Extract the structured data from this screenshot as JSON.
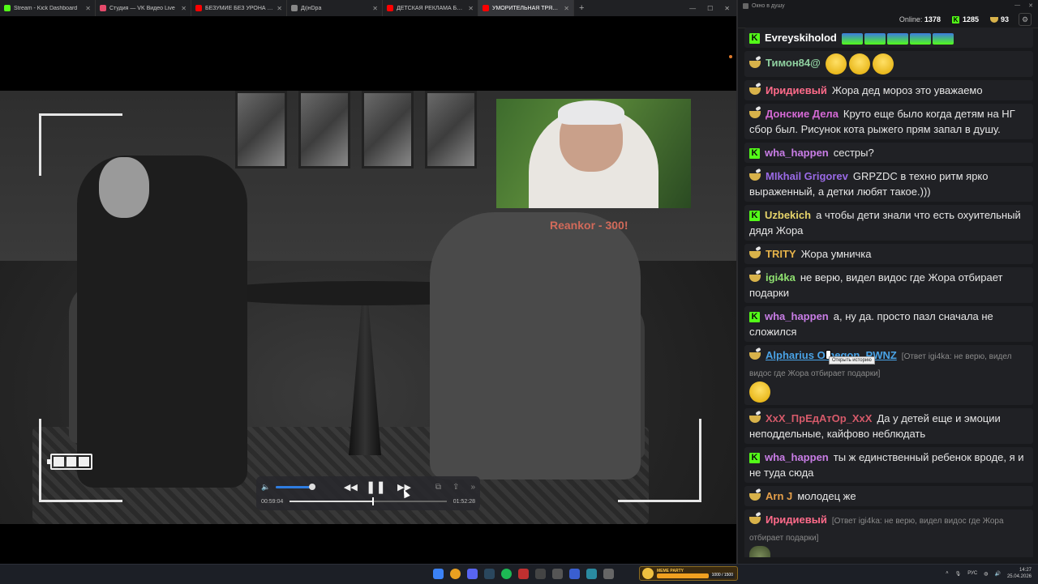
{
  "browser": {
    "tabs": [
      {
        "title": "Stream - Kick Dashboard",
        "favicon_color": "#53fc18",
        "active": false
      },
      {
        "title": "Студия — VK Видео Live",
        "favicon_color": "#e64a6b",
        "active": false
      },
      {
        "title": "БЕЗУМИЕ БЕЗ УРОНА ЗА 4 ЧАСА",
        "favicon_color": "#ff0000",
        "active": false
      },
      {
        "title": "Дi)нDра",
        "favicon_color": "#888888",
        "active": false
      },
      {
        "title": "ДЕТСКАЯ РЕКЛАМА БЛОКИРОВ",
        "favicon_color": "#ff0000",
        "active": false
      },
      {
        "title": "УМОРИТЕЛЬНАЯ ТРЯСКА ВОК",
        "favicon_color": "#ff0000",
        "active": true
      }
    ],
    "new_tab": "+"
  },
  "video": {
    "overlay_text": "Reankor - 300!",
    "player": {
      "current_time": "00:59:04",
      "total_time": "01:52:28",
      "progress_fraction": 0.525,
      "volume_fraction": 0.97
    }
  },
  "chat": {
    "window_title": "Окно в душу",
    "stats": {
      "online_label": "Online:",
      "online_count": "1378",
      "kick_count": "1285",
      "vk_count": "93"
    },
    "tooltip": "Открыть историю",
    "messages": [
      {
        "platform": "kick",
        "user": "Evreyskiholod",
        "user_color": "#ffffff",
        "text": "",
        "reply": "",
        "emotes": 5,
        "emote_style": "sq"
      },
      {
        "platform": "vk",
        "user": "Тимон84@",
        "user_color": "#8fd0a0",
        "text": "",
        "reply": "",
        "emotes": 3,
        "emote_style": "small"
      },
      {
        "platform": "vk",
        "user": "Иридиевый",
        "user_color": "#ff6b8a",
        "text": "Жора дед мороз это уважаемо",
        "reply": "",
        "emotes": 0
      },
      {
        "platform": "vk",
        "user": "Донские Дела",
        "user_color": "#d66ad6",
        "text": "Круто еще было когда детям на НГ сбор был. Рисунок кота рыжего прям запал в душу.",
        "reply": "",
        "emotes": 0
      },
      {
        "platform": "kick",
        "user": "wha_happen",
        "user_color": "#c97de6",
        "text": "сестры?",
        "reply": "",
        "emotes": 0
      },
      {
        "platform": "vk",
        "user": "MIkhail Grigorev",
        "user_color": "#9a6ae6",
        "text": "GRPZDC в техно ритм ярко выраженный, а детки любят такое.)))",
        "reply": "",
        "emotes": 0
      },
      {
        "platform": "kick",
        "user": "Uzbekich",
        "user_color": "#e6d36a",
        "text": "а чтобы дети знали что есть охуительный дядя Жора",
        "reply": "",
        "emotes": 0
      },
      {
        "platform": "vk",
        "user": "TRITY",
        "user_color": "#e6b34a",
        "text": "Жора умничка",
        "reply": "",
        "emotes": 0
      },
      {
        "platform": "vk",
        "user": "igi4ka",
        "user_color": "#8fe070",
        "text": "не верю, видел видос где Жора отбирает подарки",
        "reply": "",
        "emotes": 0
      },
      {
        "platform": "kick",
        "user": "wha_happen",
        "user_color": "#c97de6",
        "text": "а, ну да. просто пазл сначала не сложился",
        "reply": "",
        "emotes": 0
      },
      {
        "platform": "vk",
        "user": "Alpharius Omegon_PWNZ",
        "user_color": "#4aa3e6",
        "text": "",
        "reply": "[Ответ igi4ka: не верю, видел видос где Жора отбирает подарки]",
        "emotes": 1,
        "emote_style": "small"
      },
      {
        "platform": "vk",
        "user": "XxX_ПрЕдАтОр_XxX",
        "user_color": "#d65a6a",
        "text": "Да у детей еще и эмоции  неподдельные, кайфово неблюдать",
        "reply": "",
        "emotes": 0
      },
      {
        "platform": "kick",
        "user": "wha_happen",
        "user_color": "#c97de6",
        "text": "ты ж единственный ребенок вроде, я и не туда сюда",
        "reply": "",
        "emotes": 0
      },
      {
        "platform": "vk",
        "user": "Arn J",
        "user_color": "#e6a04a",
        "text": "молодец же",
        "reply": "",
        "emotes": 0
      },
      {
        "platform": "vk",
        "user": "Иридиевый",
        "user_color": "#ff6b8a",
        "text": "",
        "reply": "[Ответ igi4ka: не верю, видел видос где Жора отбирает подарки]",
        "emotes": 1,
        "emote_style": "gob"
      }
    ]
  },
  "taskbar": {
    "meme_label": "MEME PARTY",
    "meme_count": "1000 / 1500",
    "meme_fraction": 0.67,
    "lang": "РУС",
    "time": "14:27",
    "date": "25.04.2026"
  }
}
